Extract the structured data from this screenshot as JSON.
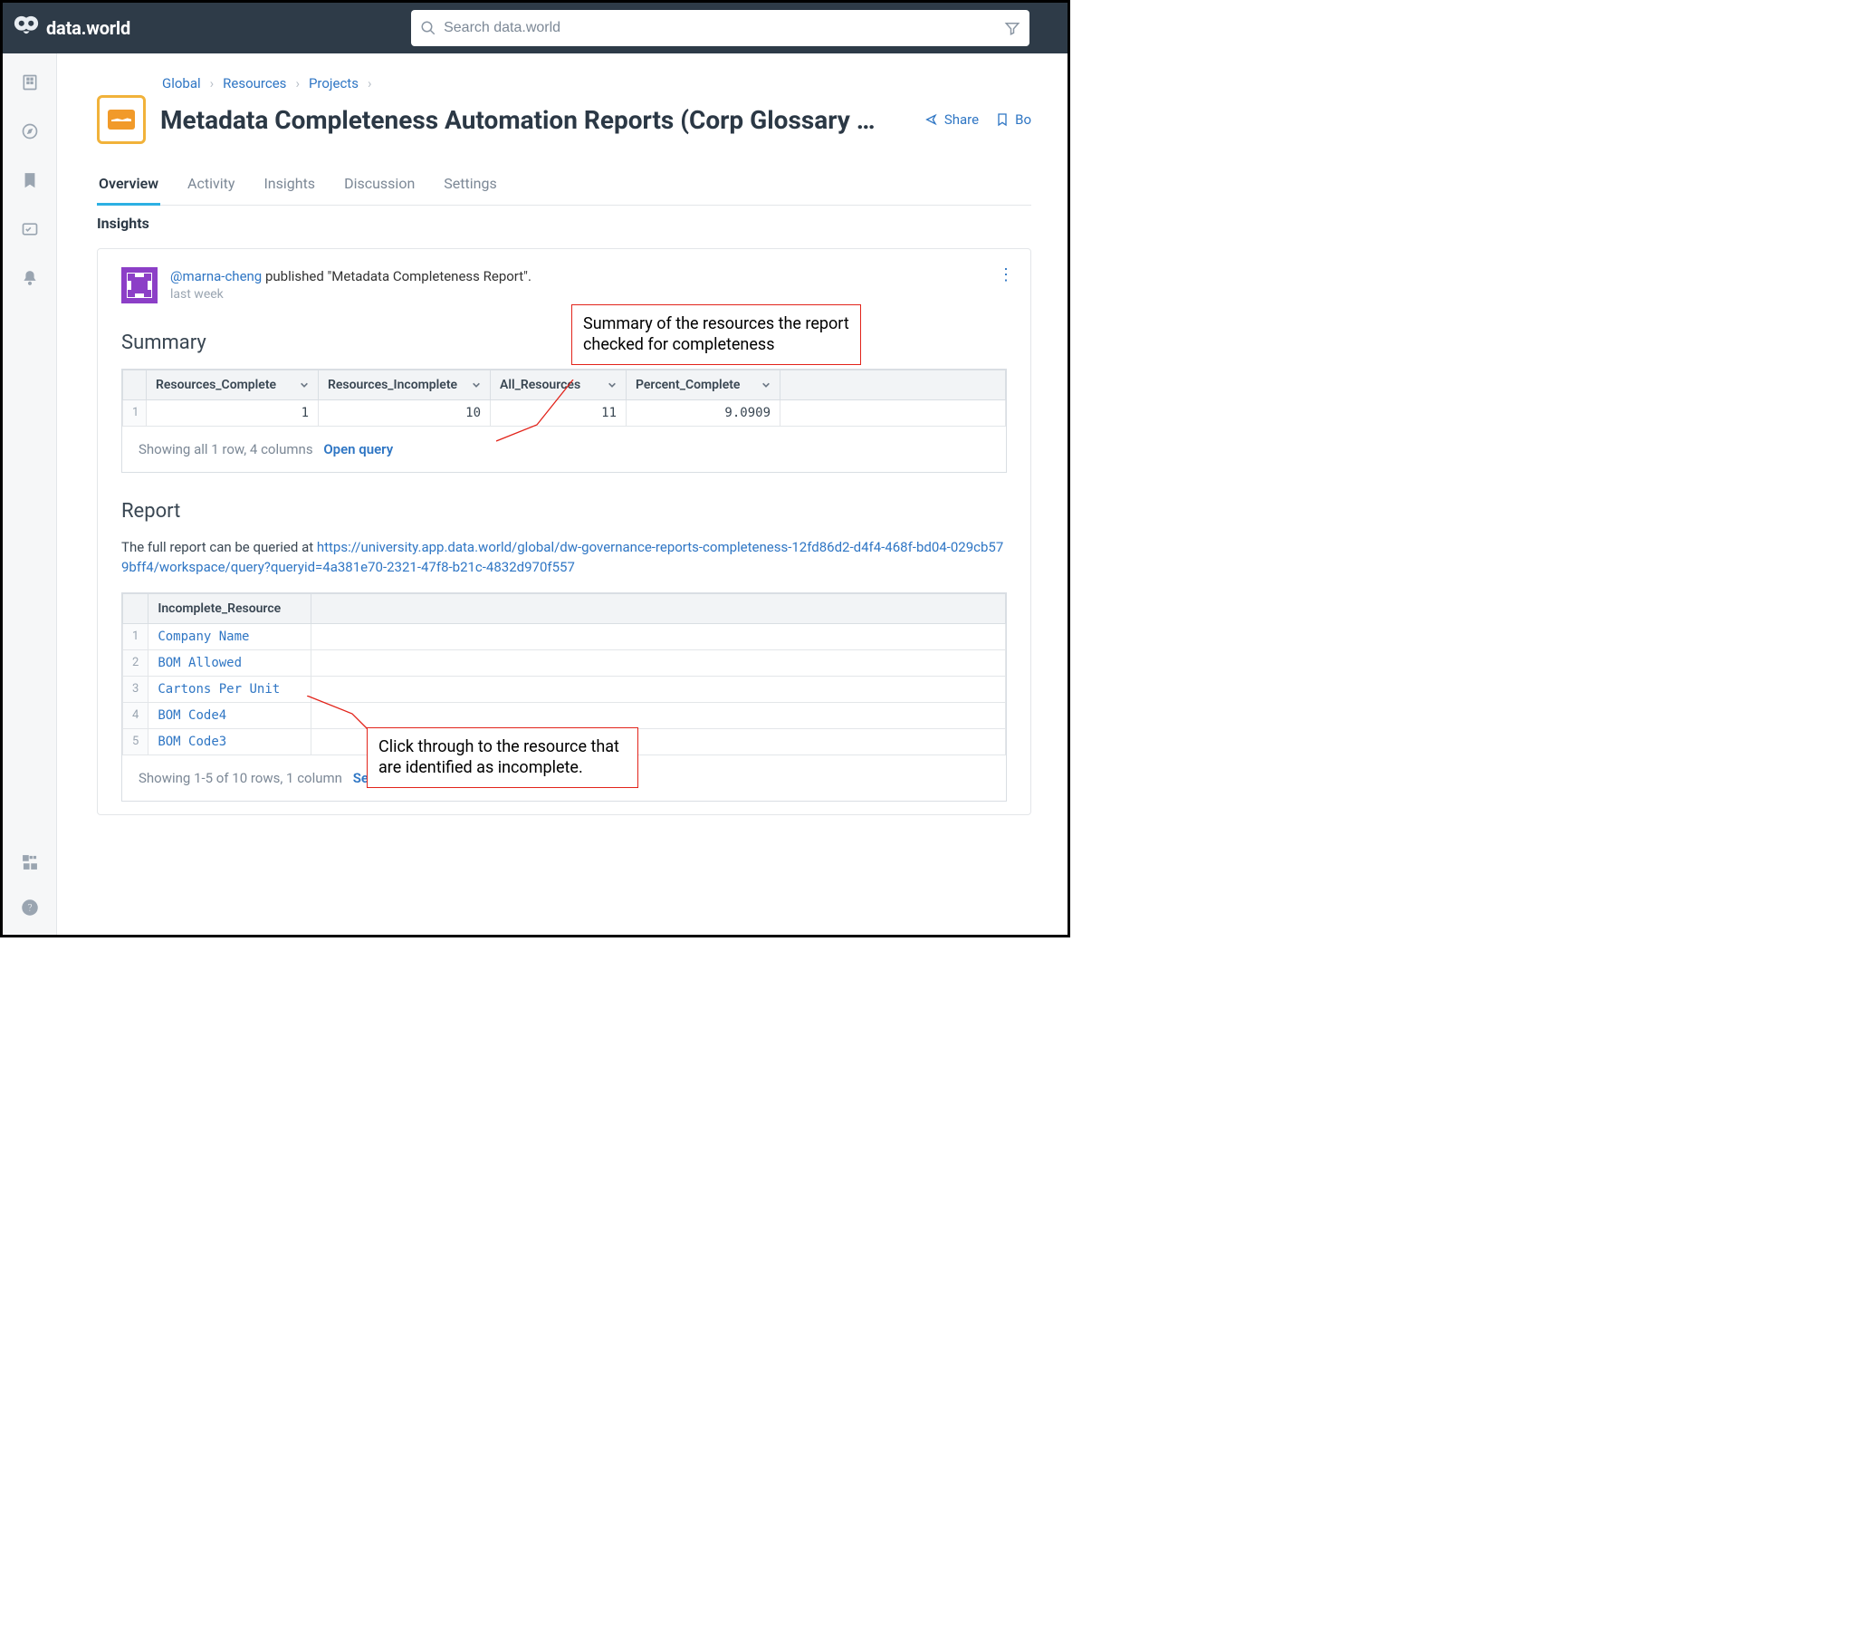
{
  "brand": "data.world",
  "search": {
    "placeholder": "Search data.world"
  },
  "breadcrumbs": [
    "Global",
    "Resources",
    "Projects"
  ],
  "page_title": "Metadata Completeness Automation Reports (Corp Glossary …",
  "actions": {
    "share": "Share",
    "bookmark": "Bo"
  },
  "tabs": [
    "Overview",
    "Activity",
    "Insights",
    "Discussion",
    "Settings"
  ],
  "section_label": "Insights",
  "insight": {
    "author_handle": "@marna-cheng",
    "action_text": " published \"Metadata Completeness Report\".",
    "time": "last week"
  },
  "summary": {
    "heading": "Summary",
    "columns": [
      "Resources_Complete",
      "Resources_Incomplete",
      "All_Resources",
      "Percent_Complete"
    ],
    "rows": [
      {
        "n": "1",
        "cells": [
          "1",
          "10",
          "11",
          "9.0909"
        ]
      }
    ],
    "footer_text": "Showing all 1 row, 4 columns",
    "footer_link": "Open query"
  },
  "report": {
    "heading": "Report",
    "intro": "The full report can be queried at ",
    "url": "https://university.app.data.world/global/dw-governance-reports-completeness-12fd86d2-d4f4-468f-bd04-029cb579bff4/workspace/query?queryid=4a381e70-2321-47f8-b21c-4832d970f557",
    "column": "Incomplete_Resource",
    "rows": [
      {
        "n": "1",
        "v": "Company Name"
      },
      {
        "n": "2",
        "v": "BOM Allowed"
      },
      {
        "n": "3",
        "v": "Cartons Per Unit"
      },
      {
        "n": "4",
        "v": "BOM Code4"
      },
      {
        "n": "5",
        "v": "BOM Code3"
      }
    ],
    "footer_text": "Showing 1-5 of 10 rows, 1 column",
    "footer_link": "See all"
  },
  "annotations": {
    "summary": "Summary of the resources the report checked for completeness",
    "clickthrough": "Click through to the resource that are identified as incomplete."
  }
}
